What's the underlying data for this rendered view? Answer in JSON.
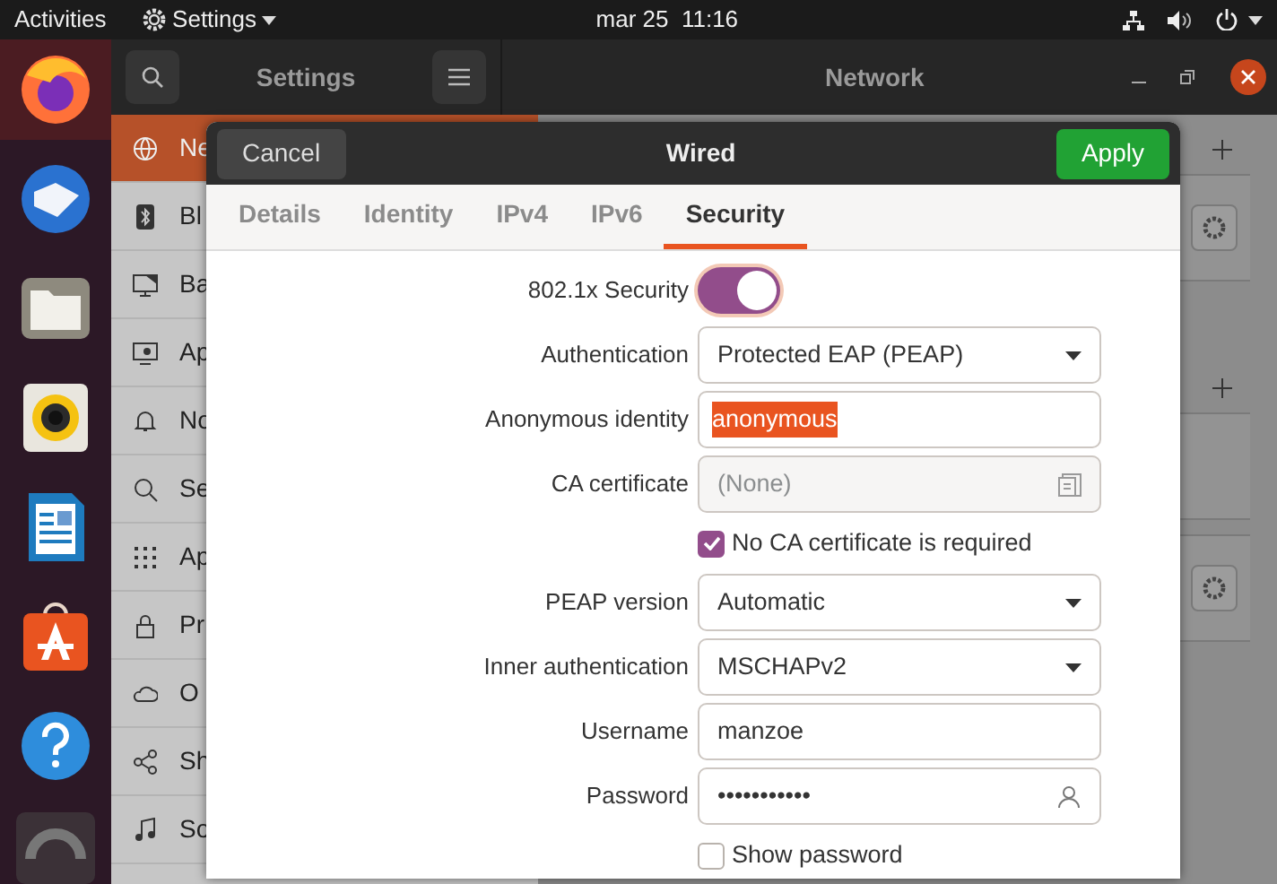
{
  "top_bar": {
    "activities": "Activities",
    "app_menu": "Settings",
    "clock": "mar 25  11:16"
  },
  "dock": [
    {
      "kind": "browser",
      "selected": true
    },
    {
      "kind": "mail",
      "selected": false
    },
    {
      "kind": "files",
      "selected": false
    },
    {
      "kind": "music",
      "selected": false
    },
    {
      "kind": "document",
      "selected": false
    },
    {
      "kind": "store",
      "selected": false
    },
    {
      "kind": "help",
      "selected": false
    },
    {
      "kind": "disc",
      "selected": false
    }
  ],
  "settings_window": {
    "sidebar_title": "Settings",
    "title": "Network",
    "sidebar": [
      {
        "label": "Ne",
        "selected": true
      },
      {
        "label": "Bl",
        "selected": false
      },
      {
        "label": "Ba",
        "selected": false
      },
      {
        "label": "Ap",
        "selected": false
      },
      {
        "label": "No",
        "selected": false
      },
      {
        "label": "Se",
        "selected": false
      },
      {
        "label": "Ap",
        "selected": false
      },
      {
        "label": "Pr",
        "selected": false
      },
      {
        "label": "O",
        "selected": false
      },
      {
        "label": "Sh",
        "selected": false
      },
      {
        "label": "So",
        "selected": false
      }
    ]
  },
  "dialog": {
    "title": "Wired",
    "cancel": "Cancel",
    "apply": "Apply",
    "tabs": [
      {
        "label": "Details",
        "selected": false
      },
      {
        "label": "Identity",
        "selected": false
      },
      {
        "label": "IPv4",
        "selected": false
      },
      {
        "label": "IPv6",
        "selected": false
      },
      {
        "label": "Security",
        "selected": true
      }
    ],
    "fields": [
      {
        "kind": "switch",
        "label": "802.1x Security",
        "on": true
      },
      {
        "kind": "dropdown",
        "label": "Authentication",
        "value": "Protected EAP (PEAP)"
      },
      {
        "kind": "text",
        "label": "Anonymous identity",
        "value": "anonymous",
        "text_selected": true
      },
      {
        "kind": "file",
        "label": "CA certificate",
        "placeholder": "(None)"
      },
      {
        "kind": "checkbox",
        "label": "No CA certificate is required",
        "checked": true
      },
      {
        "kind": "dropdown",
        "label": "PEAP version",
        "value": "Automatic"
      },
      {
        "kind": "dropdown",
        "label": "Inner authentication",
        "value": "MSCHAPv2"
      },
      {
        "kind": "text",
        "label": "Username",
        "value": "manzoe",
        "text_selected": false
      },
      {
        "kind": "password",
        "label": "Password",
        "value": "•••••••••••"
      },
      {
        "kind": "checkbox",
        "label": "Show password",
        "checked": false
      }
    ]
  }
}
